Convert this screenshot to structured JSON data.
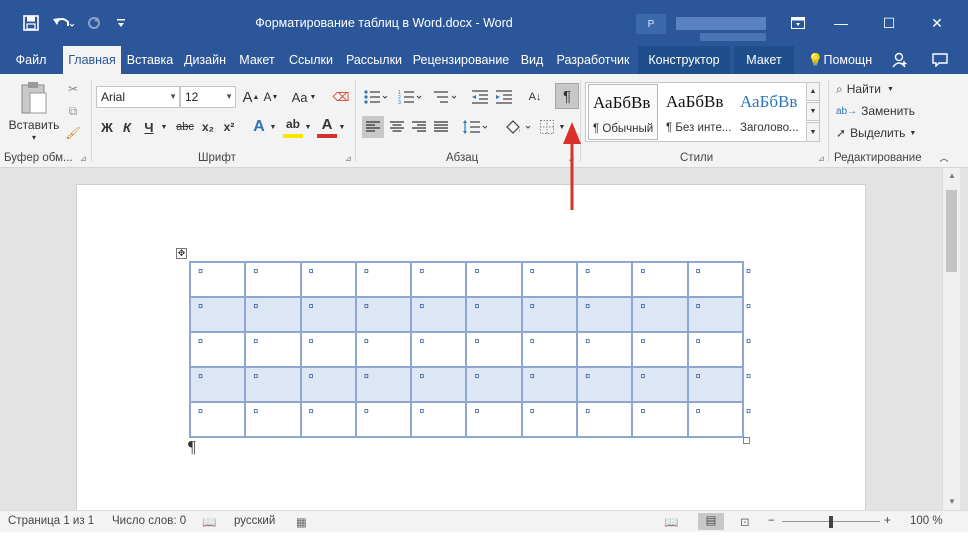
{
  "window": {
    "title": "Форматирование таблиц в Word.docx - Word",
    "account_initial": "Р"
  },
  "quick_access": {
    "save_icon": "save-icon",
    "undo_icon": "undo-icon",
    "redo_icon": "redo-icon",
    "customize_icon": "customize-icon"
  },
  "window_controls": {
    "ribbon_options_icon": "ribbon-display-icon",
    "minimize": "—",
    "maximize": "☐",
    "close": "✕"
  },
  "tabs": [
    {
      "label": "Файл"
    },
    {
      "label": "Главная"
    },
    {
      "label": "Вставка"
    },
    {
      "label": "Дизайн"
    },
    {
      "label": "Макет"
    },
    {
      "label": "Ссылки"
    },
    {
      "label": "Рассылки"
    },
    {
      "label": "Рецензирование"
    },
    {
      "label": "Вид"
    },
    {
      "label": "Разработчик"
    },
    {
      "label": "Конструктор"
    },
    {
      "label": "Макет"
    },
    {
      "label": "Помощн"
    }
  ],
  "ribbon": {
    "clipboard": {
      "paste_label": "Вставить",
      "group_label": "Буфер обм..."
    },
    "font": {
      "font_name": "Arial",
      "font_size": "12",
      "grow": "A",
      "shrink": "A",
      "case": "Aa",
      "bold": "Ж",
      "italic": "К",
      "underline": "Ч",
      "strike": "abc",
      "subscript": "x₂",
      "superscript": "x²",
      "text_effects": "A",
      "highlight": "ab",
      "font_color": "A",
      "group_label": "Шрифт"
    },
    "paragraph": {
      "show_marks": "¶",
      "sort": "А↓",
      "group_label": "Абзац"
    },
    "styles": {
      "items": [
        {
          "preview": "АаБбВв",
          "name": "¶ Обычный"
        },
        {
          "preview": "АаБбВв",
          "name": "¶ Без инте..."
        },
        {
          "preview": "АаБбВв",
          "name": "Заголово..."
        }
      ],
      "group_label": "Стили"
    },
    "editing": {
      "find": "Найти",
      "replace": "Заменить",
      "select": "Выделить",
      "group_label": "Редактирование"
    }
  },
  "document": {
    "cell_mark": "¤",
    "paragraph_mark": "¶",
    "table": {
      "rows": 5,
      "cols": 10,
      "rows_data": [
        [
          "¤",
          "¤",
          "¤",
          "¤",
          "¤",
          "¤",
          "¤",
          "¤",
          "¤",
          "¤"
        ],
        [
          "¤",
          "¤",
          "¤",
          "¤",
          "¤",
          "¤",
          "¤",
          "¤",
          "¤",
          "¤"
        ],
        [
          "¤",
          "¤",
          "¤",
          "¤",
          "¤",
          "¤",
          "¤",
          "¤",
          "¤",
          "¤"
        ],
        [
          "¤",
          "¤",
          "¤",
          "¤",
          "¤",
          "¤",
          "¤",
          "¤",
          "¤",
          "¤"
        ],
        [
          "¤",
          "¤",
          "¤",
          "¤",
          "¤",
          "¤",
          "¤",
          "¤",
          "¤",
          "¤"
        ]
      ],
      "row_end_mark": "¤"
    }
  },
  "status": {
    "page": "Страница 1 из 1",
    "words": "Число слов: 0",
    "language": "русский",
    "zoom": "100 %",
    "zoom_minus": "−",
    "zoom_plus": "+"
  },
  "colors": {
    "accent": "#2b579a",
    "ribbon_bg": "#f3f3f3",
    "table_border": "#8ea7d0",
    "table_band": "#dde6f4",
    "arrow": "#d9312b"
  }
}
